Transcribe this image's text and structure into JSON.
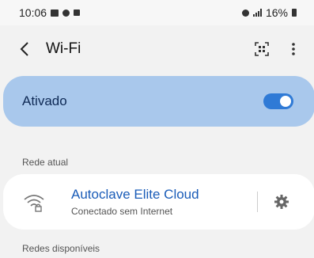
{
  "status_bar": {
    "time": "10:06",
    "battery": "16%"
  },
  "header": {
    "title": "Wi-Fi"
  },
  "toggle": {
    "label": "Ativado",
    "state": "on",
    "accent": "#2f7ad6"
  },
  "sections": {
    "current": "Rede atual",
    "available": "Redes disponíveis"
  },
  "current_network": {
    "name": "Autoclave Elite Cloud",
    "status": "Conectado sem Internet"
  },
  "icons": [
    "back-arrow-icon",
    "qr-code-icon",
    "more-vert-icon",
    "wifi-locked-icon",
    "gear-icon"
  ]
}
